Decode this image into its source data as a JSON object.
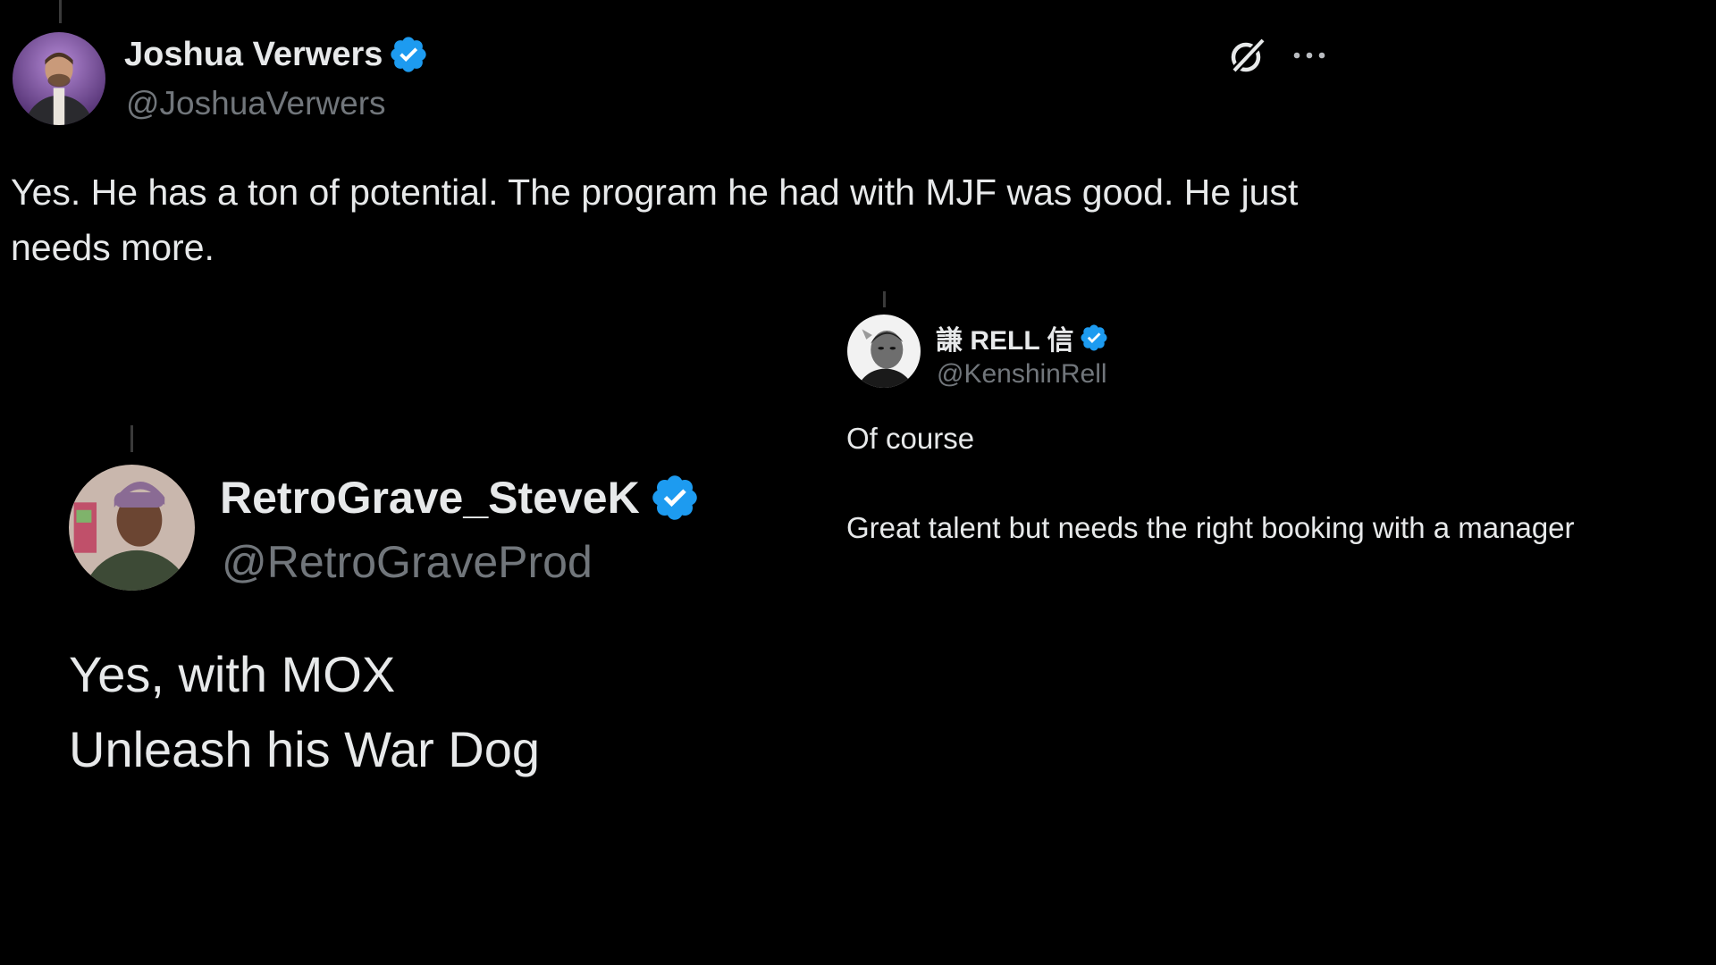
{
  "post_main": {
    "display_name": "Joshua Verwers",
    "handle": "@JoshuaVerwers",
    "verified": true,
    "text": "Yes. He has a ton of potential. The program he had with MJF was good. He just needs more.",
    "actions": {
      "grok_icon": "grok-icon",
      "more_icon": "more-horizontal-icon"
    }
  },
  "post_rell": {
    "display_name": "謙 RELL 信",
    "handle": "@KenshinRell",
    "verified": true,
    "lines": [
      "Of course",
      "Great talent but needs the right booking with a manager"
    ]
  },
  "post_steve": {
    "display_name": "RetroGrave_SteveK",
    "handle": "@RetroGraveProd",
    "verified": true,
    "lines": [
      "Yes, with MOX",
      "Unleash his War Dog"
    ]
  },
  "colors": {
    "background": "#000000",
    "text_primary": "#e7e9ea",
    "text_secondary": "#71767b",
    "verified_badge": "#1d9bf0"
  }
}
